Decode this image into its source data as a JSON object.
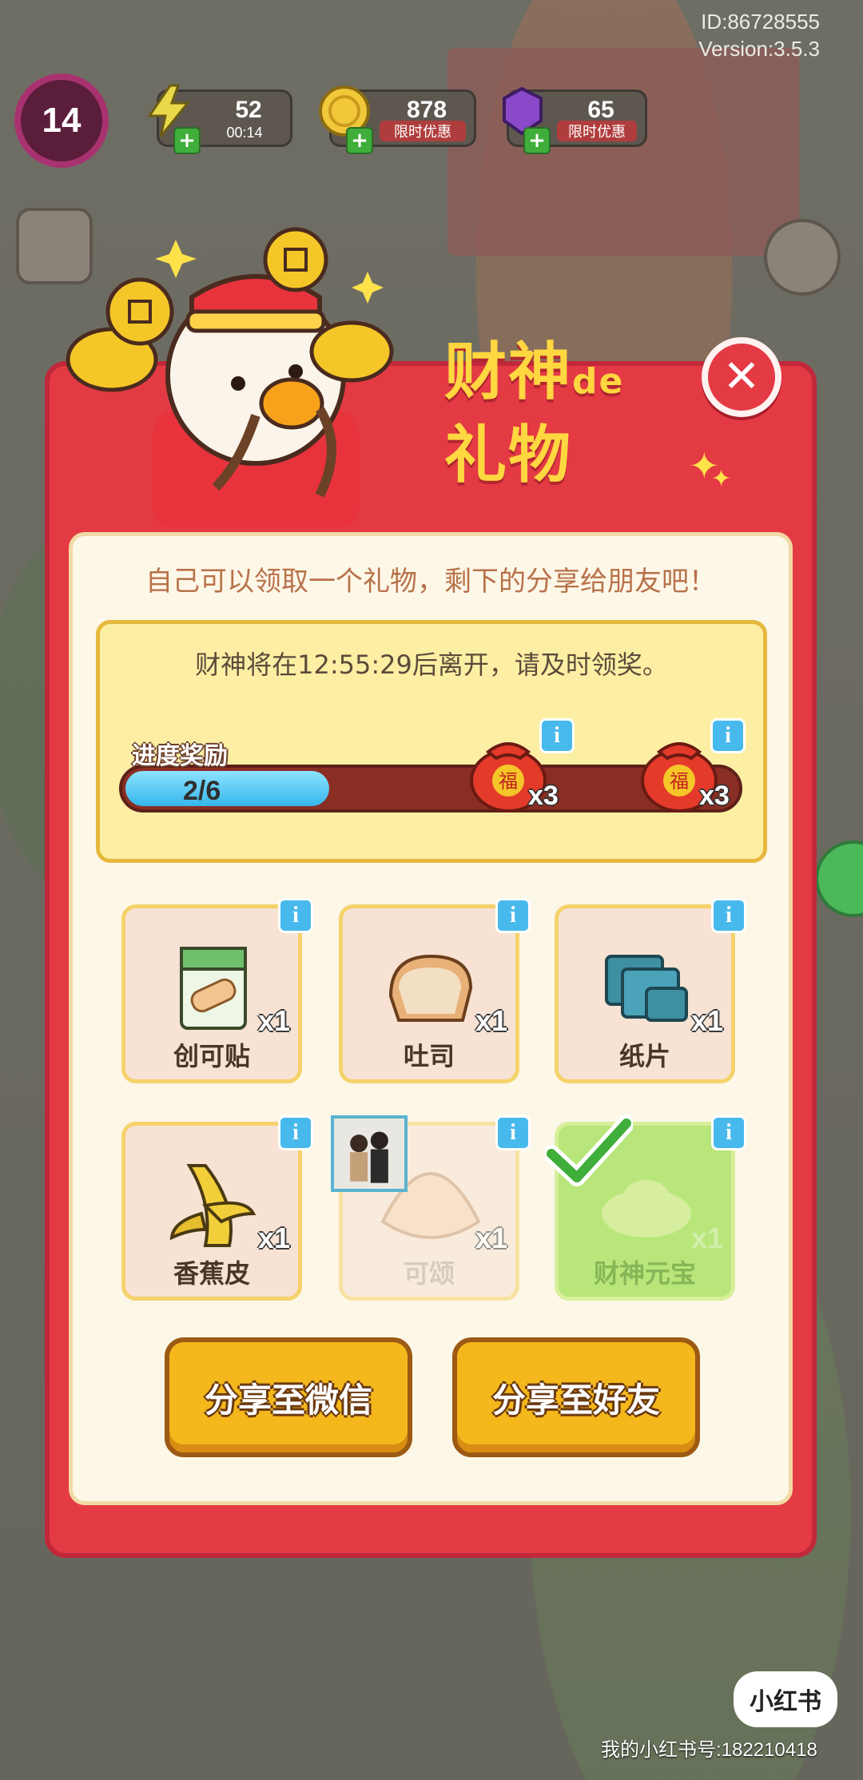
{
  "device": {
    "id_text": "ID:86728555",
    "version_text": "Version:3.5.3"
  },
  "hud": {
    "level": "14",
    "energy": {
      "value": "52",
      "sub": "00:14",
      "icon": "lightning-icon"
    },
    "coins": {
      "value": "878",
      "sub": "限时优惠",
      "icon": "coin-icon"
    },
    "gems": {
      "value": "65",
      "sub": "限时优惠",
      "icon": "gem-icon"
    }
  },
  "modal": {
    "title_line1": "财神",
    "title_de": "de",
    "title_line2": "礼物",
    "close_icon": "close-icon",
    "instructions": "自己可以领取一个礼物，剩下的分享给朋友吧！",
    "timer_text": "财神将在12:55:29后离开，请及时领奖。",
    "progress": {
      "label": "进度奖励",
      "text": "2/6",
      "current": 2,
      "total": 6,
      "rewards": [
        {
          "icon": "lucky-bag-icon",
          "qty": "x3"
        },
        {
          "icon": "lucky-bag-icon",
          "qty": "x3"
        }
      ]
    },
    "items": [
      {
        "name": "创可贴",
        "qty": "x1",
        "state": "normal",
        "icon": "bandage-box-icon"
      },
      {
        "name": "吐司",
        "qty": "x1",
        "state": "normal",
        "icon": "toast-icon"
      },
      {
        "name": "纸片",
        "qty": "x1",
        "state": "normal",
        "icon": "paper-stack-icon"
      },
      {
        "name": "香蕉皮",
        "qty": "x1",
        "state": "normal",
        "icon": "banana-peel-icon"
      },
      {
        "name": "可颂",
        "qty": "x1",
        "state": "taken",
        "icon": "croissant-icon"
      },
      {
        "name": "财神元宝",
        "qty": "x1",
        "state": "claimed",
        "icon": "gold-ingot-icon"
      }
    ],
    "buttons": {
      "share_wechat": "分享至微信",
      "share_friend": "分享至好友"
    }
  },
  "watermark": {
    "logo": "小红书",
    "id_text": "我的小红书号:182210418"
  },
  "colors": {
    "modal_red": "#e43a44",
    "title_yellow": "#ffd740",
    "progress_blue": "#35b6ea",
    "button_yellow": "#f4b81d"
  }
}
